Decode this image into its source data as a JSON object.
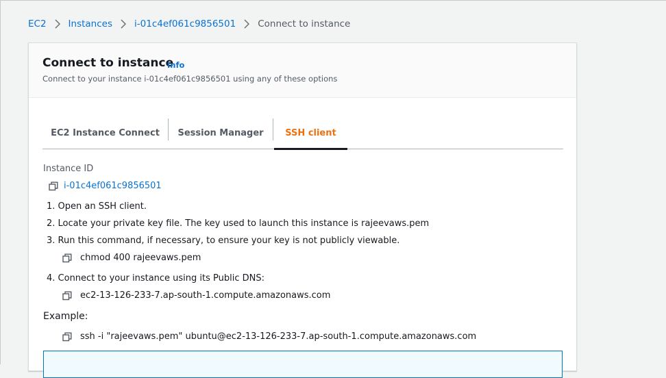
{
  "breadcrumb": {
    "items": [
      "EC2",
      "Instances",
      "i-01c4ef061c9856501"
    ],
    "current": "Connect to instance"
  },
  "panel": {
    "title": "Connect to instance",
    "info": "Info",
    "description": "Connect to your instance i-01c4ef061c9856501 using any of these options"
  },
  "tabs": {
    "items": [
      "EC2 Instance Connect",
      "Session Manager",
      "SSH client"
    ],
    "active": "SSH client"
  },
  "ssh": {
    "instance_id_label": "Instance ID",
    "instance_id": "i-01c4ef061c9856501",
    "step1": "1. Open an SSH client.",
    "step2": "2. Locate your private key file. The key used to launch this instance is rajeevaws.pem",
    "step3": "3. Run this command, if necessary, to ensure your key is not publicly viewable.",
    "chmod_cmd": "chmod 400 rajeevaws.pem",
    "step4": "4. Connect to your instance using its Public DNS:",
    "public_dns": "ec2-13-126-233-7.ap-south-1.compute.amazonaws.com",
    "example_label": "Example:",
    "example_cmd": "ssh -i \"rajeevaws.pem\" ubuntu@ec2-13-126-233-7.ap-south-1.compute.amazonaws.com"
  },
  "colors": {
    "link": "#0972d3",
    "active_tab": "#ec7211",
    "page_bg": "#f2f3f3"
  }
}
